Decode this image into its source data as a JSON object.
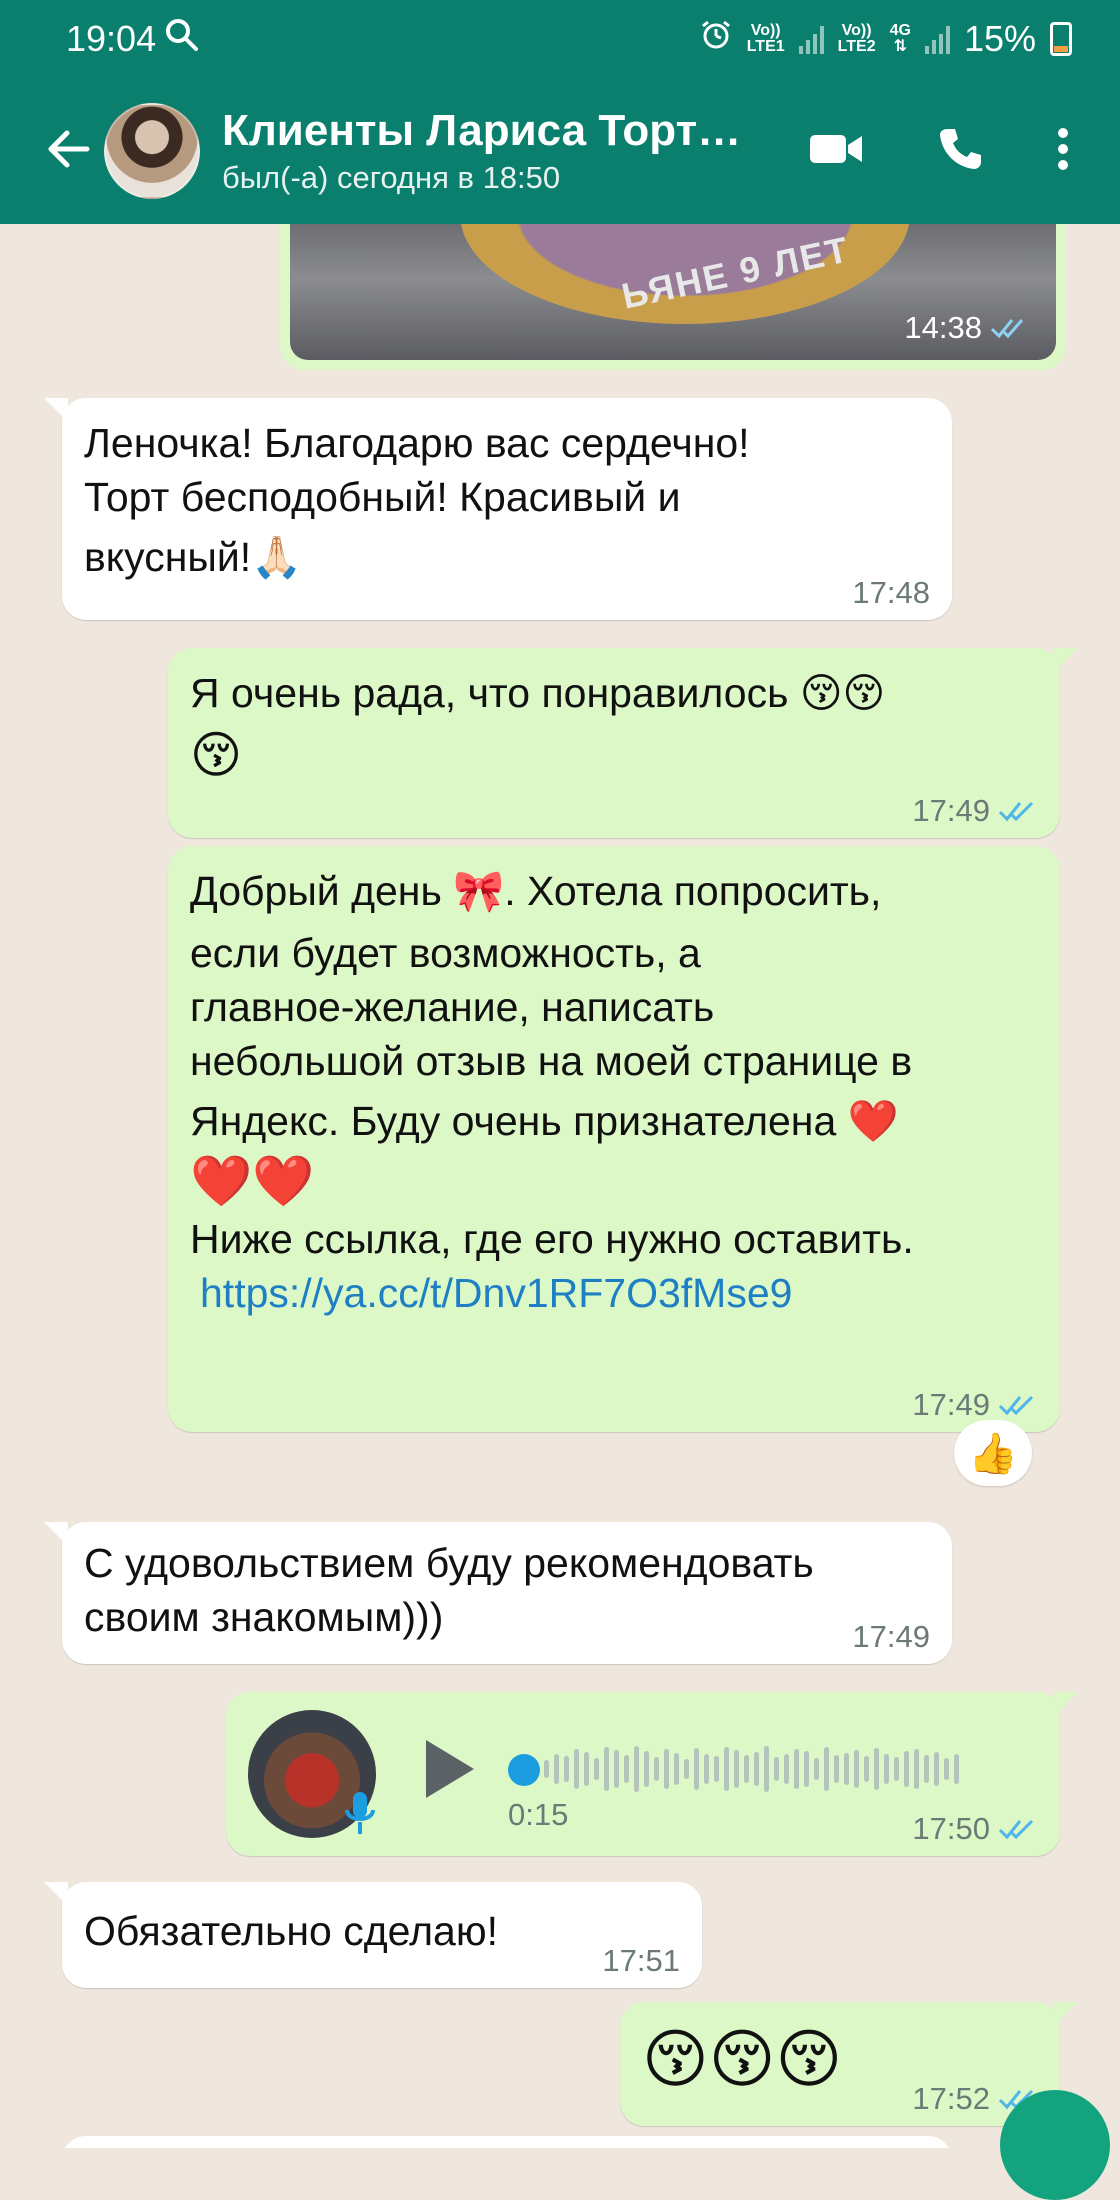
{
  "status_bar": {
    "time": "19:04",
    "sim1_line1": "Vo))",
    "sim1_line2": "LTE1",
    "sim2_line1": "Vo))",
    "sim2_line2": "LTE2",
    "network": "4G",
    "battery": "15%"
  },
  "header": {
    "title": "Клиенты Лариса Торт…",
    "subtitle": "был(-а) сегодня в 18:50"
  },
  "image_message": {
    "caption_text": "ЬЯНЕ 9 ЛЕТ",
    "time": "14:38"
  },
  "messages": [
    {
      "direction": "in",
      "lines": [
        "Леночка! Благодарю вас сердечно!",
        "Торт бесподобный!  Красивый и",
        "вкусный!🙏🏻"
      ],
      "time": "17:48"
    },
    {
      "direction": "out",
      "lines": [
        "Я очень рада,  что понравилось 😚😚",
        "😚"
      ],
      "time": "17:49"
    },
    {
      "direction": "out",
      "lines": [
        "Добрый день 🎀.  Хотела попросить,",
        "если будет возможность,  а",
        "главное-желание,  написать",
        "небольшой отзыв на моей странице в",
        "Яндекс.  Буду очень признателена ❤️",
        "❤️❤️",
        "Ниже ссылка, где его нужно оставить."
      ],
      "link": "https://ya.cc/t/Dnv1RF7O3fMse9",
      "time": "17:49",
      "reaction": "👍"
    },
    {
      "direction": "in",
      "lines": [
        "С удовольствием буду рекомендовать",
        "своим знакомым)))"
      ],
      "time": "17:49"
    },
    {
      "direction": "out",
      "type": "voice",
      "duration": "0:15",
      "time": "17:50"
    },
    {
      "direction": "in",
      "lines": [
        "Обязательно сделаю!"
      ],
      "time": "17:51"
    },
    {
      "direction": "out",
      "lines": [
        "😚😚😚"
      ],
      "time": "17:52"
    }
  ],
  "icons": {
    "back": "arrow-left-icon",
    "video": "video-camera-icon",
    "call": "phone-icon",
    "menu": "more-vertical-icon",
    "read": "double-check-icon",
    "play": "play-icon",
    "mic": "microphone-icon"
  },
  "colors": {
    "header": "#0a7f6d",
    "outgoing": "#dcf8c6",
    "incoming": "#ffffff",
    "read_ticks": "#4fb6ec",
    "chat_bg": "#efe7de"
  }
}
